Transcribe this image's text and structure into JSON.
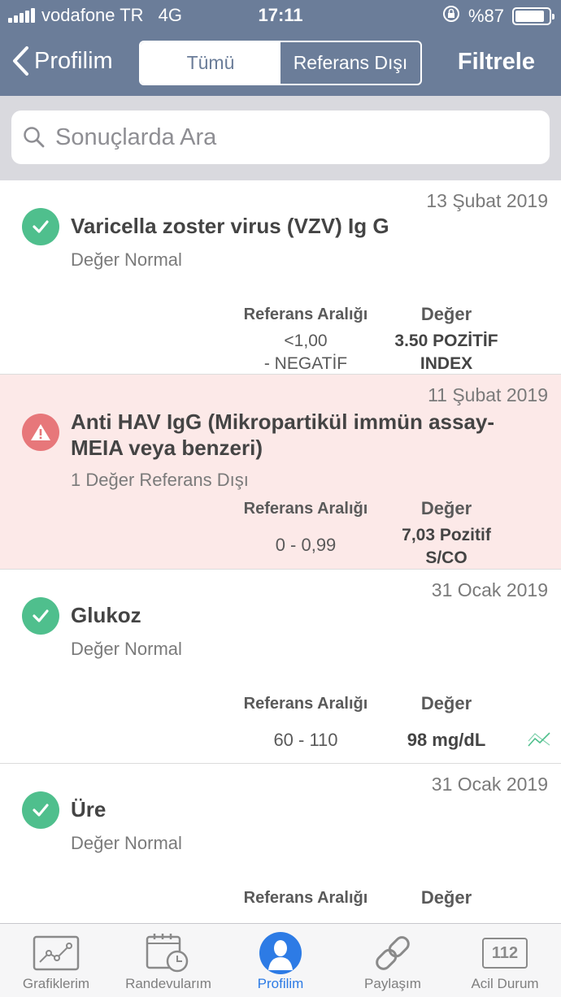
{
  "status_bar": {
    "carrier": "vodafone TR",
    "network": "4G",
    "time": "17:11",
    "battery_text": "%87",
    "battery_level": 0.87
  },
  "nav": {
    "back_label": "Profilim",
    "segments": [
      "Tümü",
      "Referans Dışı"
    ],
    "filter_label": "Filtrele"
  },
  "search": {
    "placeholder": "Sonuçlarda Ara"
  },
  "results": [
    {
      "date": "13 Şubat 2019",
      "title": "Varicella zoster virus (VZV) Ig G",
      "status": "Değer Normal",
      "ref_header": "Referans Aralığı",
      "value_header": "Değer",
      "ref_lines": [
        "<1,00",
        "-  NEGATİF"
      ],
      "value_lines": [
        "3.50 POZİTİF",
        "INDEX"
      ]
    },
    {
      "date": "11 Şubat 2019",
      "title_lines": [
        "Anti HAV IgG (Mikropartikül immün assay-",
        "MEIA veya benzeri)"
      ],
      "status": "1 Değer Referans Dışı",
      "ref_header": "Referans Aralığı",
      "value_header": "Değer",
      "ref": "0 - 0,99",
      "value_lines": [
        "7,03 Pozitif",
        "S/CO"
      ]
    },
    {
      "date": "31 Ocak 2019",
      "title": "Glukoz",
      "status": "Değer Normal",
      "ref_header": "Referans Aralığı",
      "value_header": "Değer",
      "ref": "60 - 110",
      "value": "98 mg/dL"
    },
    {
      "date": "31 Ocak 2019",
      "title": "Üre",
      "status": "Değer Normal",
      "ref_header": "Referans Aralığı",
      "value_header": "Değer"
    }
  ],
  "tabs": [
    {
      "label": "Grafiklerim",
      "icon": "chart-icon"
    },
    {
      "label": "Randevularım",
      "icon": "calendar-icon"
    },
    {
      "label": "Profilim",
      "icon": "profile-icon",
      "active": true
    },
    {
      "label": "Paylaşım",
      "icon": "link-icon"
    },
    {
      "label": "Acil Durum",
      "icon": "emergency-icon",
      "icon_text": "112"
    }
  ],
  "colors": {
    "nav": "#6b7d99",
    "ok": "#4fbf8d",
    "error": "#e7777a",
    "warn_bg": "#fce9e8",
    "active_tab": "#2d7be5"
  }
}
